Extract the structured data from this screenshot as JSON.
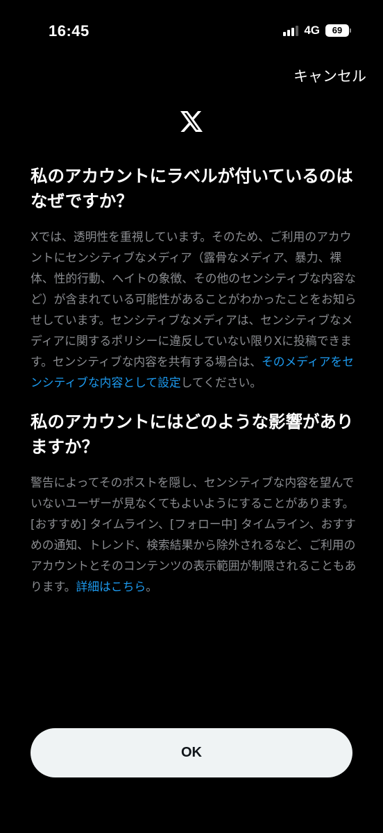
{
  "status_bar": {
    "time": "16:45",
    "network": "4G",
    "battery": "69",
    "signal_icon": "signal-bars-icon",
    "battery_icon": "battery-icon"
  },
  "header": {
    "cancel_label": "キャンセル",
    "logo_icon": "x-logo-icon"
  },
  "section1": {
    "title": "私のアカウントにラベルが付いているのはなぜですか？",
    "body_before_link": "Xでは、透明性を重視しています。そのため、ご利用のアカウントにセンシティブなメディア（露骨なメディア、暴力、裸体、性的行動、ヘイトの象徴、その他のセンシティブな内容など）が含まれている可能性があることがわかったことをお知らせしています。センシティブなメディアは、センシティブなメディアに関するポリシーに違反していない限りXに投稿できます。センシティブな内容を共有する場合は、",
    "link_text": "そのメディアをセンシティブな内容として設定",
    "body_after_link": "してください。"
  },
  "section2": {
    "title": "私のアカウントにはどのような影響がありますか？",
    "body_before_link": "警告によってそのポストを隠し、センシティブな内容を望んでいないユーザーが見なくてもよいようにすることがあります。[おすすめ] タイムライン、[フォロー中] タイムライン、おすすめの通知、トレンド、検索結果から除外されるなど、ご利用のアカウントとそのコンテンツの表示範囲が制限されることもあります。",
    "link_text": "詳細はこちら",
    "body_after_link": "。"
  },
  "footer": {
    "ok_label": "OK"
  },
  "colors": {
    "background": "#000000",
    "body_text": "#8b8d91",
    "link": "#1d9bf0",
    "button_bg": "#eff3f4",
    "button_text": "#0f1419"
  }
}
